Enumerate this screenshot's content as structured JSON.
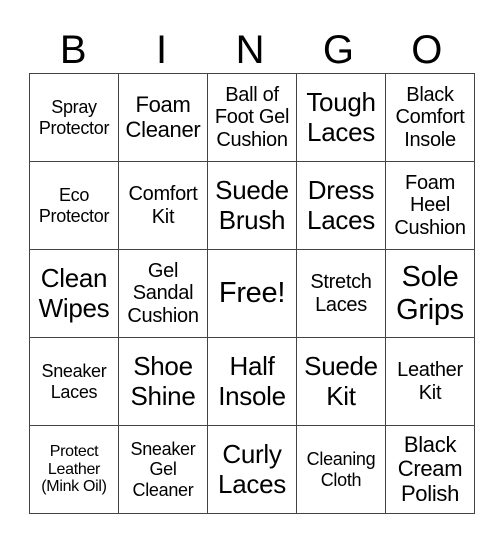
{
  "header": {
    "letters": [
      "B",
      "I",
      "N",
      "G",
      "O"
    ]
  },
  "board": {
    "rows": [
      [
        "Spray Protector",
        "Foam Cleaner",
        "Ball of Foot Gel Cushion",
        "Tough Laces",
        "Black Comfort Insole"
      ],
      [
        "Eco Protector",
        "Comfort Kit",
        "Suede Brush",
        "Dress Laces",
        "Foam Heel Cushion"
      ],
      [
        "Clean Wipes",
        "Gel Sandal Cushion",
        "Free!",
        "Stretch Laces",
        "Sole Grips"
      ],
      [
        "Sneaker Laces",
        "Shoe Shine",
        "Half Insole",
        "Suede Kit",
        "Leather Kit"
      ],
      [
        "Protect Leather (Mink Oil)",
        "Sneaker Gel Cleaner",
        "Curly Laces",
        "Cleaning Cloth",
        "Black Cream Polish"
      ]
    ]
  }
}
